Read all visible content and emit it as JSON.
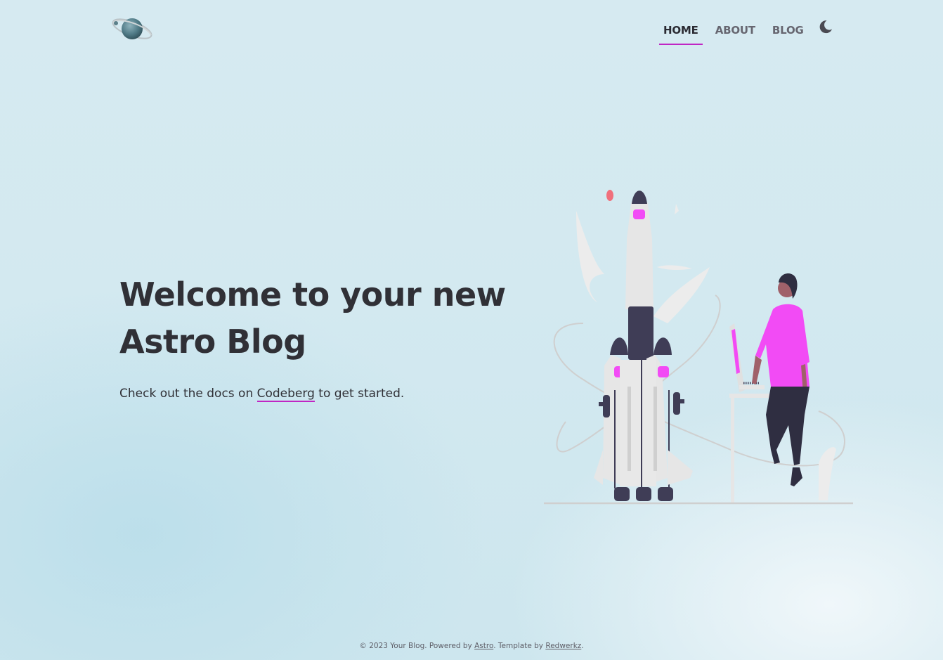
{
  "header": {
    "logo_icon": "planet-logo-icon",
    "nav": [
      {
        "label": "HOME",
        "active": true
      },
      {
        "label": "ABOUT",
        "active": false
      },
      {
        "label": "BLOG",
        "active": false
      }
    ],
    "theme_toggle_icon": "moon-icon"
  },
  "hero": {
    "title_line1": "Welcome to your new",
    "title_line2": "Astro Blog",
    "subtitle_before": "Check out the docs on ",
    "subtitle_link": "Codeberg",
    "subtitle_after": " to get started.",
    "illustration_icon": "rocket-launch-illustration"
  },
  "footer": {
    "prefix": "© 2023 Your Blog. Powered by ",
    "astro_link": "Astro",
    "middle": ". Template by ",
    "author_link": "Redwerkz",
    "suffix": "."
  },
  "colors": {
    "accent": "#c026c4",
    "figure_shirt": "#f24bf5",
    "rocket_dark": "#3f3d56",
    "text": "#303036"
  }
}
